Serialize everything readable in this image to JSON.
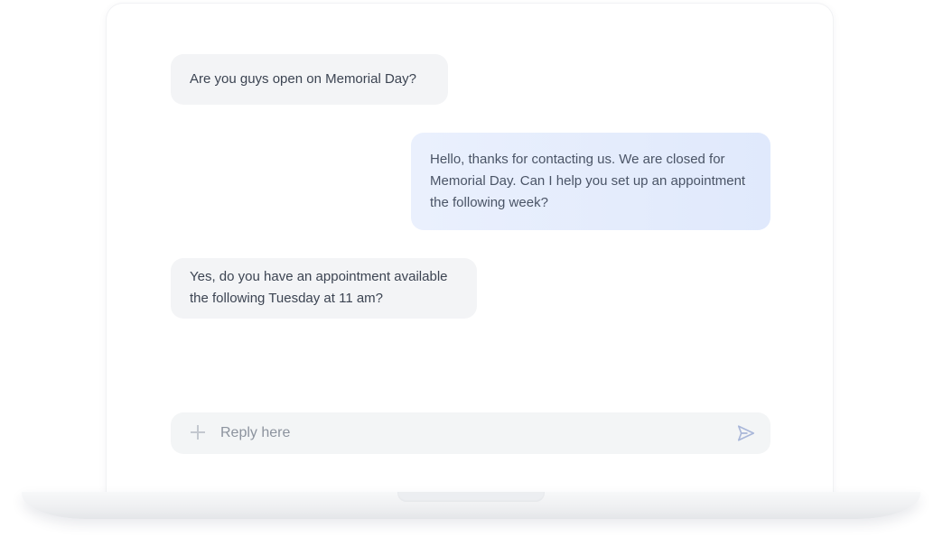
{
  "conversation": {
    "messages": [
      {
        "sender": "customer",
        "text": "Are you guys open on Memorial Day?"
      },
      {
        "sender": "business",
        "text": "Hello, thanks for contacting us. We are closed for Memorial Day. Can I help you set up an appointment the following week?"
      },
      {
        "sender": "customer",
        "text": "Yes, do you have an appointment available the following Tuesday at 11 am?"
      }
    ]
  },
  "composer": {
    "placeholder": "Reply here",
    "value": "",
    "attach_icon": "plus-icon",
    "send_icon": "send-icon"
  },
  "colors": {
    "incoming_bubble": "#f3f4f6",
    "outgoing_bubble": "#e4ecfc",
    "text": "#3c4452",
    "placeholder": "#8c939e",
    "send_icon": "#a9b7d9"
  }
}
